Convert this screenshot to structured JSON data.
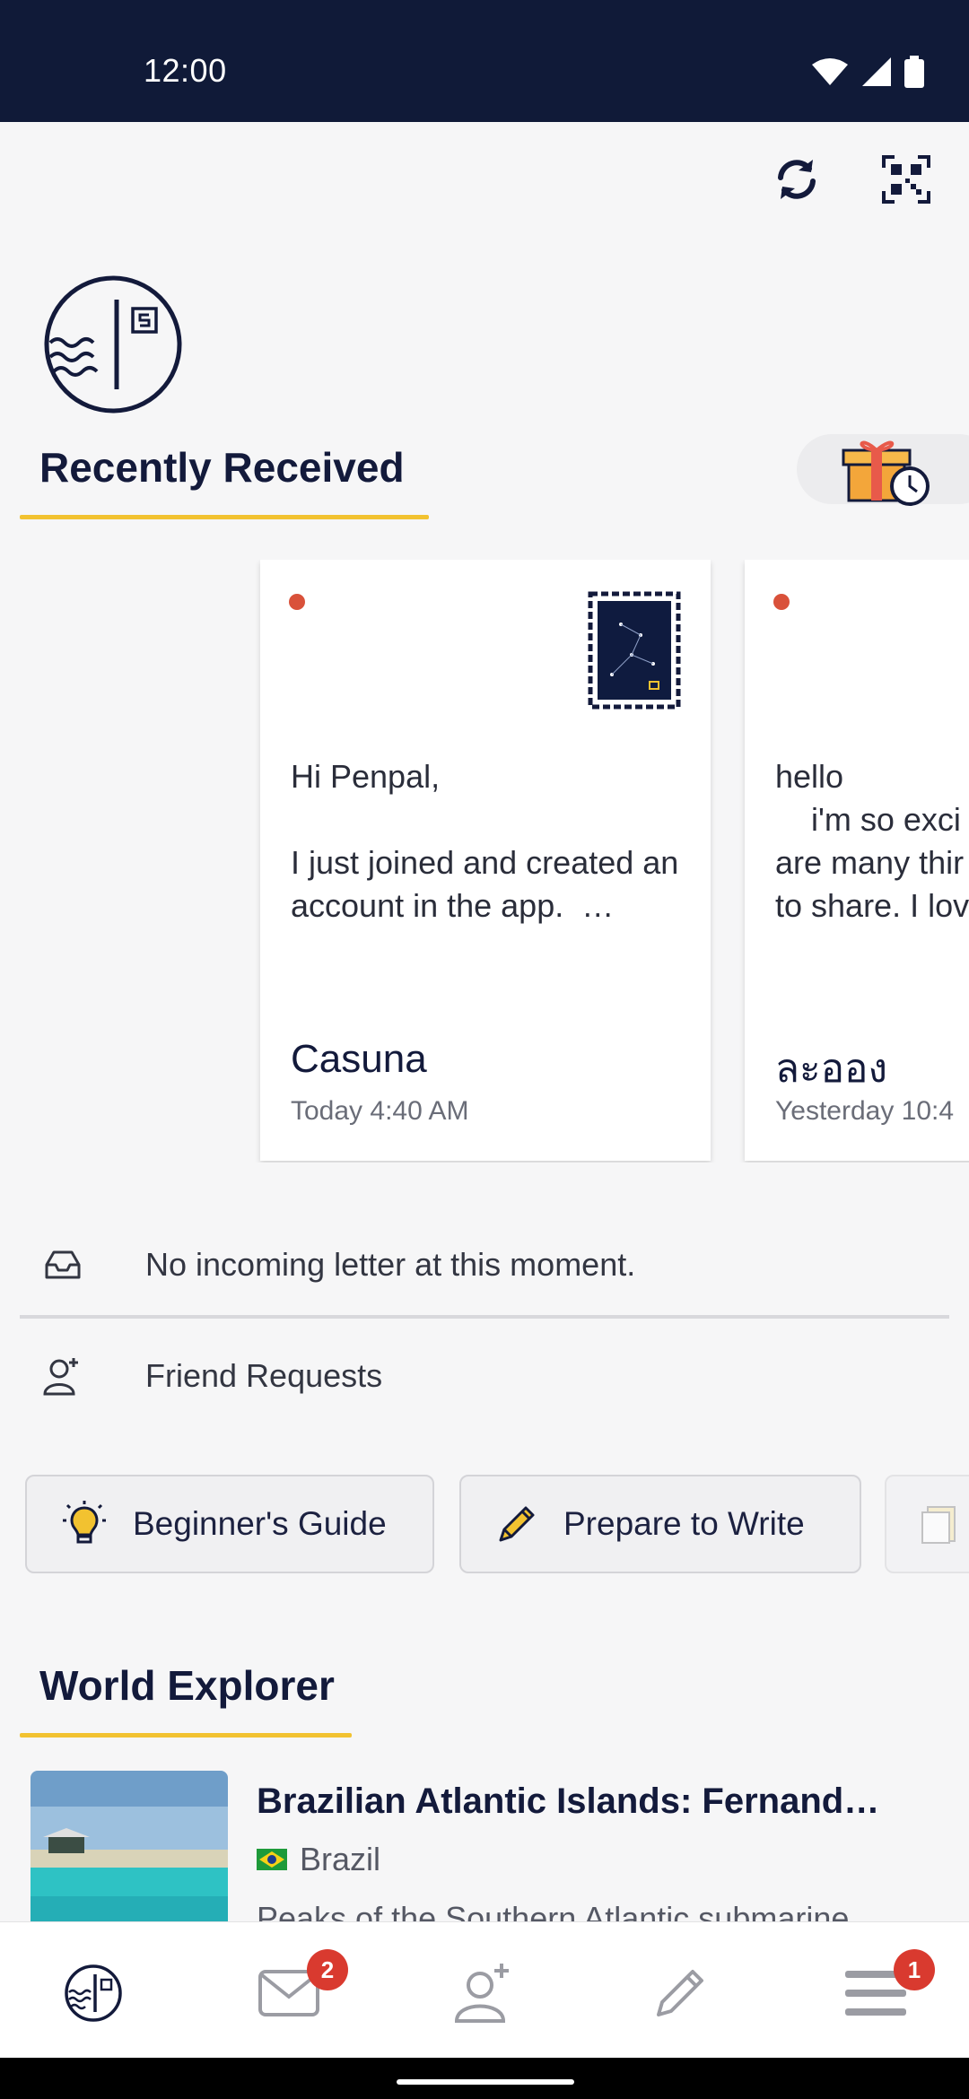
{
  "status_bar": {
    "time": "12:00",
    "icons": [
      "wifi-icon",
      "signal-icon",
      "battery-icon"
    ]
  },
  "header": {
    "actions": [
      "refresh-icon",
      "qr-code-icon"
    ]
  },
  "recently_received": {
    "title": "Recently Received",
    "letters": [
      {
        "body": "Hi Penpal,\n\nI just joined and created an account in the app.  …",
        "sender": "Casuna",
        "date": "Today 4:40 AM",
        "unread": true,
        "stamp": "constellation-stamp"
      },
      {
        "body": "hello\n    i'm so exci\nare many thir\nto share. I lov",
        "sender": "ละออง",
        "date": "Yesterday 10:4",
        "unread": true
      }
    ]
  },
  "incoming": {
    "text": "No incoming letter at this moment."
  },
  "friend_requests": {
    "label": "Friend Requests"
  },
  "chips": [
    {
      "label": "Beginner's Guide",
      "icon": "lightbulb-icon"
    },
    {
      "label": "Prepare to Write",
      "icon": "pencil-icon"
    }
  ],
  "world_explorer": {
    "title": "World Explorer",
    "article": {
      "title": "Brazilian Atlantic Islands: Fernand…",
      "country": "Brazil",
      "description": "Peaks of the Southern Atlantic submarine"
    }
  },
  "bottom_nav": {
    "items": [
      {
        "icon": "home-logo-icon",
        "badge": ""
      },
      {
        "icon": "mail-icon",
        "badge": "2"
      },
      {
        "icon": "add-friend-icon",
        "badge": ""
      },
      {
        "icon": "pencil-icon",
        "badge": ""
      },
      {
        "icon": "menu-icon",
        "badge": "1"
      }
    ]
  },
  "colors": {
    "navy": "#101a38",
    "accent_yellow": "#f2c230",
    "unread_dot": "#d9513a",
    "badge_red": "#d93a2f"
  }
}
